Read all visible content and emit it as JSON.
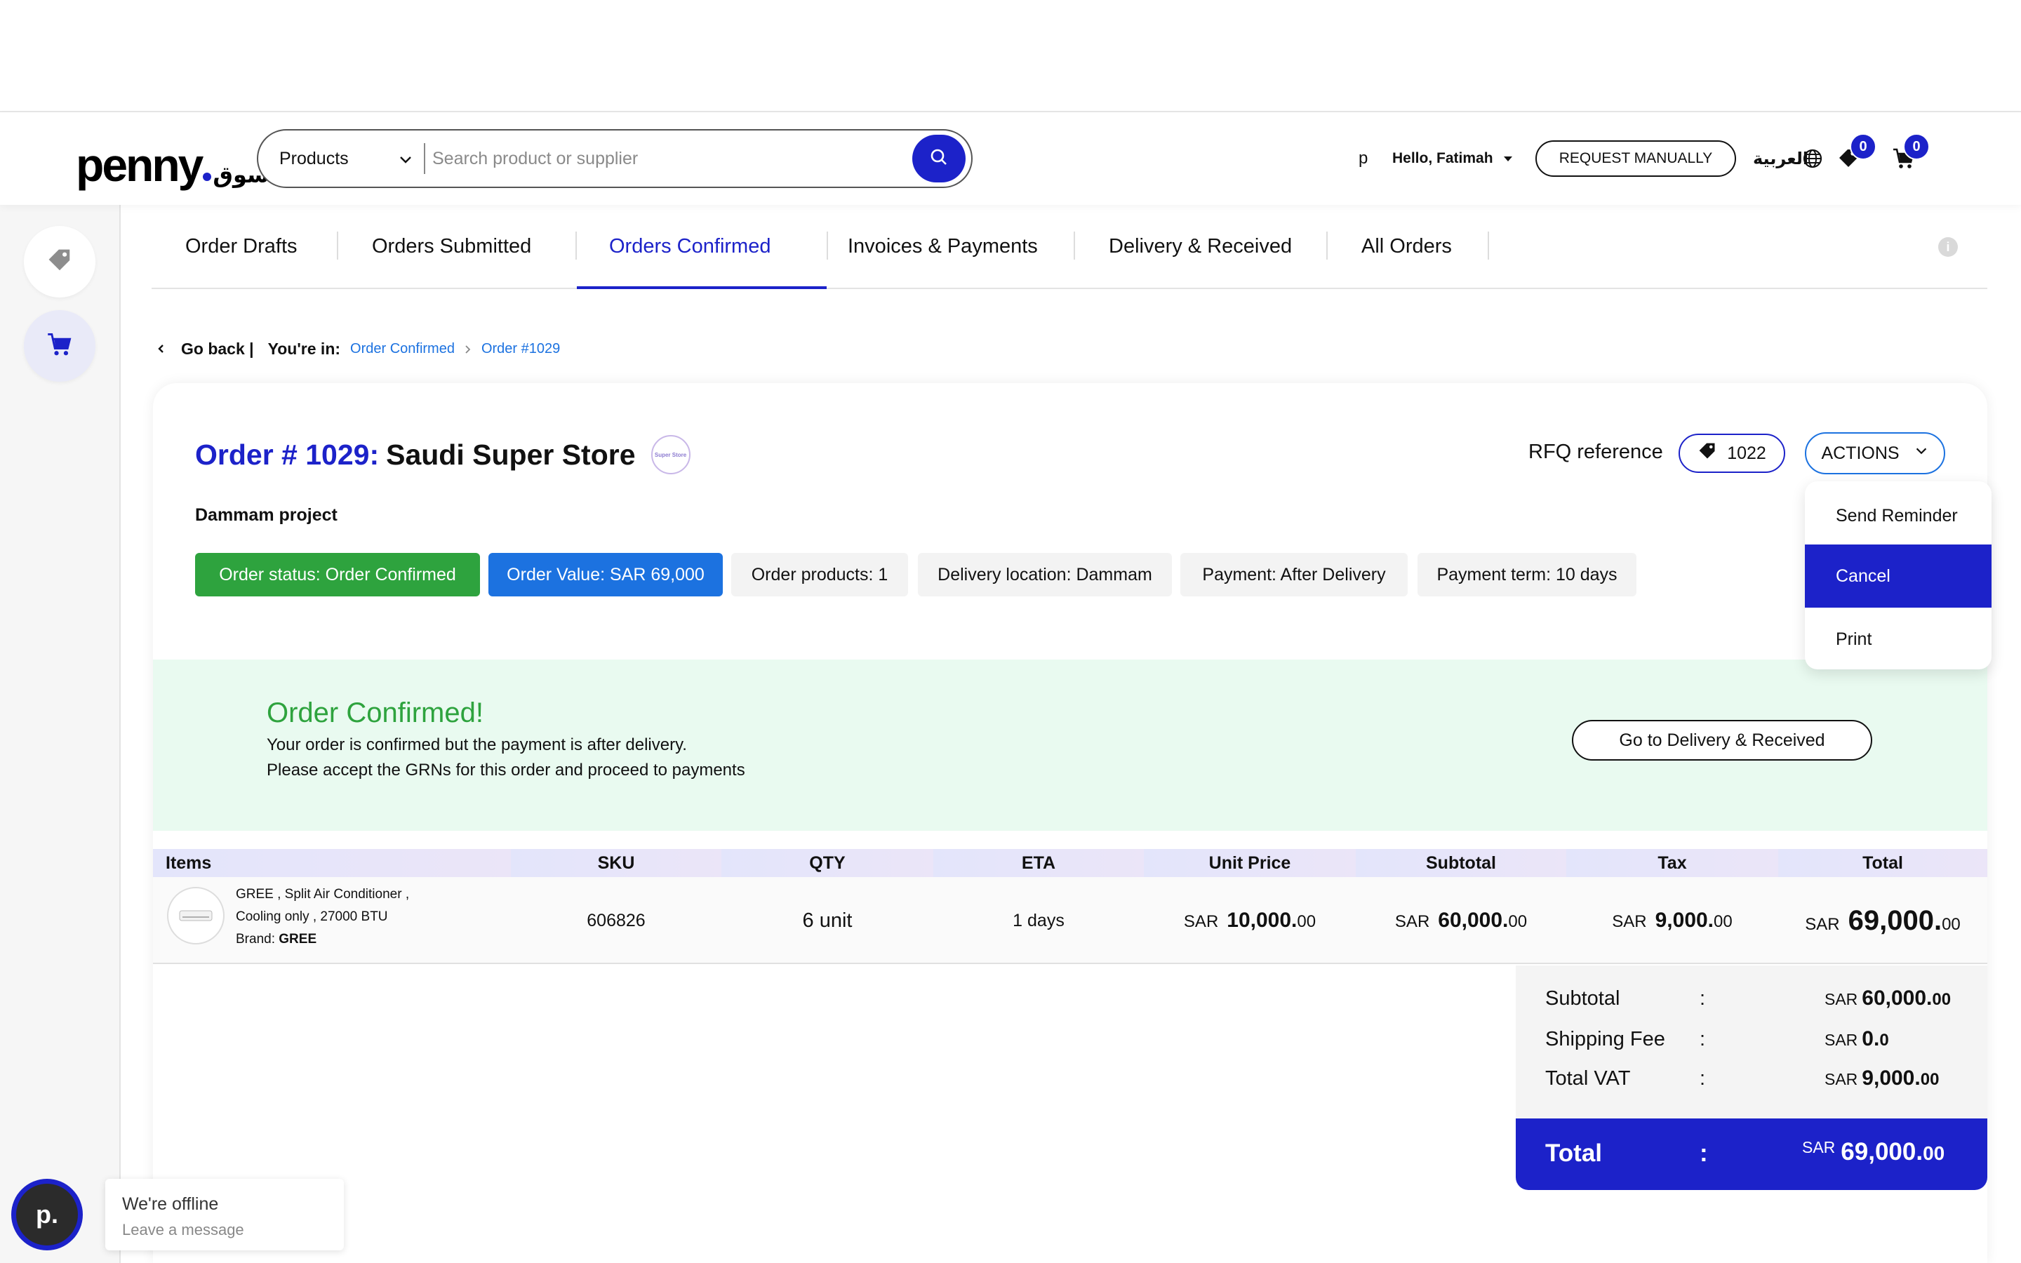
{
  "brand": {
    "name": "penny",
    "sub": "سوق"
  },
  "search": {
    "category": "Products",
    "placeholder": "Search product or supplier"
  },
  "header": {
    "user_initial": "p",
    "greeting": "Hello, Fatimah",
    "request_manually": "REQUEST MANUALLY",
    "language": "العربية",
    "wishlist_count": "0",
    "cart_count": "0"
  },
  "tabs": [
    {
      "label": "Order Drafts"
    },
    {
      "label": "Orders Submitted"
    },
    {
      "label": "Orders Confirmed"
    },
    {
      "label": "Invoices & Payments"
    },
    {
      "label": "Delivery & Received"
    },
    {
      "label": "All Orders"
    }
  ],
  "active_tab": "Orders Confirmed",
  "breadcrumb": {
    "go_back": "Go back |",
    "you_are_in": "You're in:",
    "items": [
      "Order Confirmed",
      "Order #1029"
    ]
  },
  "order": {
    "number_label": "Order # 1029:",
    "store": "Saudi Super Store",
    "store_logo_text": "Super Store",
    "project": "Dammam project",
    "rfq_label": "RFQ reference",
    "rfq_value": "1022",
    "actions_label": "ACTIONS",
    "actions_menu": [
      "Send Reminder",
      "Cancel",
      "Print"
    ],
    "chips": [
      "Order status: Order Confirmed",
      "Order Value: SAR 69,000",
      "Order products: 1",
      "Delivery location: Dammam",
      "Payment: After Delivery",
      "Payment term: 10 days"
    ]
  },
  "banner": {
    "title": "Order Confirmed!",
    "line1": "Your order is confirmed but the payment is after delivery.",
    "line2": "Please accept the GRNs for this order and proceed to payments",
    "button": "Go to Delivery & Received"
  },
  "table": {
    "headers": [
      "Items",
      "SKU",
      "QTY",
      "ETA",
      "Unit Price",
      "Subtotal",
      "Tax",
      "Total"
    ],
    "row": {
      "name_line1": "GREE , Split Air Conditioner ,",
      "name_line2": "Cooling only , 27000 BTU",
      "brand_label": "Brand:",
      "brand": "GREE",
      "sku": "606826",
      "qty": "6 unit",
      "eta": "1 days",
      "unit_price": {
        "cur": "SAR",
        "int": "10,000.",
        "dec": "00"
      },
      "subtotal": {
        "cur": "SAR",
        "int": "60,000.",
        "dec": "00"
      },
      "tax": {
        "cur": "SAR",
        "int": "9,000.",
        "dec": "00"
      },
      "total": {
        "cur": "SAR",
        "int": "69,000.",
        "dec": "00"
      }
    }
  },
  "summary": {
    "subtotal": {
      "label": "Subtotal",
      "cur": "SAR",
      "int": "60,000.",
      "dec": "00"
    },
    "shipping": {
      "label": "Shipping Fee",
      "cur": "SAR",
      "int": "0.",
      "dec": "0"
    },
    "vat": {
      "label": "Total VAT",
      "cur": "SAR",
      "int": "9,000.",
      "dec": "00"
    },
    "total": {
      "label": "Total",
      "cur": "SAR",
      "int": "69,000.",
      "dec": "00"
    },
    "colon": ":"
  },
  "chat": {
    "avatar": "p.",
    "status": "We're offline",
    "prompt": "Leave a message"
  },
  "colors": {
    "primary": "#1c22c9",
    "link": "#1c72e0",
    "success": "#2ea33e",
    "banner_bg": "#e9faf0"
  }
}
